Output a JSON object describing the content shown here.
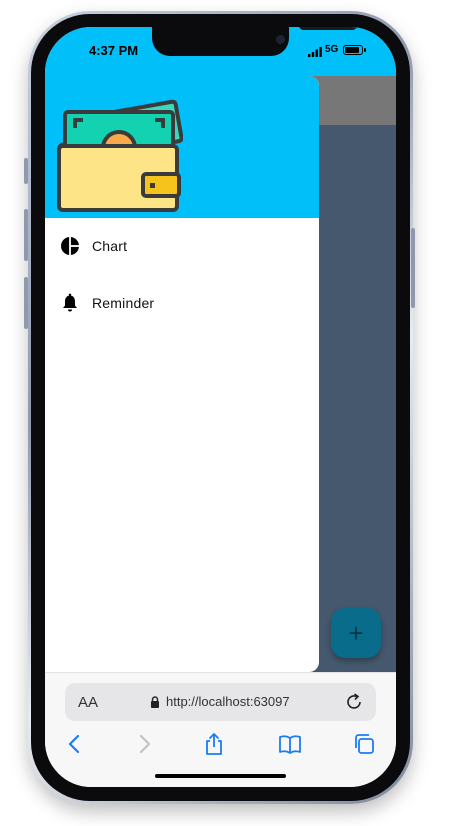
{
  "status_bar": {
    "time": "4:37 PM",
    "network": "5G",
    "signal_icon": "signal-bars-icon",
    "battery_icon": "battery-icon"
  },
  "drawer": {
    "header_image": "wallet-icon",
    "items": [
      {
        "label": "Chart",
        "icon": "pie-chart-icon"
      },
      {
        "label": "Reminder",
        "icon": "bell-icon"
      }
    ]
  },
  "fab": {
    "label": "+",
    "icon": "plus-icon"
  },
  "browser": {
    "text_size_label": "AA",
    "url": "http://localhost:63097",
    "toolbar": [
      "back-icon",
      "forward-icon",
      "share-icon",
      "bookmarks-icon",
      "tabs-icon"
    ]
  },
  "colors": {
    "primary": "#01bff8",
    "scrim": "#45586d",
    "fab": "#086c8a",
    "ios_blue": "#1a7cf5"
  }
}
